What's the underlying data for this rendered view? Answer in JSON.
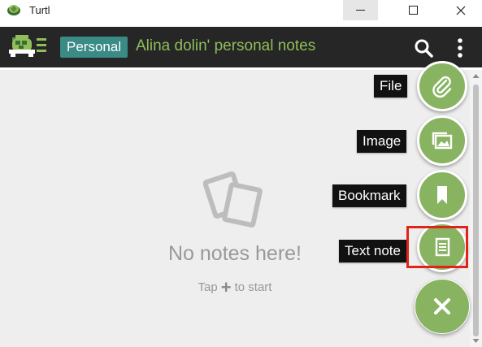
{
  "window": {
    "title": "Turtl",
    "minimize_icon": "minimize-icon",
    "maximize_icon": "maximize-icon",
    "close_icon": "close-icon"
  },
  "header": {
    "space_badge": "Personal",
    "title": "Alina dolin' personal notes",
    "accent_color": "#8fbf5a",
    "badge_color": "#3a8a85"
  },
  "empty_state": {
    "icon": "empty-notes-icon",
    "title": "No notes here!",
    "hint_prefix": "Tap",
    "hint_suffix": "to start"
  },
  "fab_menu": {
    "items": [
      {
        "label": "File",
        "icon": "paperclip-icon"
      },
      {
        "label": "Image",
        "icon": "image-icon"
      },
      {
        "label": "Bookmark",
        "icon": "bookmark-icon"
      },
      {
        "label": "Text note",
        "icon": "document-icon",
        "highlighted": true
      }
    ],
    "close_icon": "close-x-icon",
    "color": "#88b462"
  }
}
